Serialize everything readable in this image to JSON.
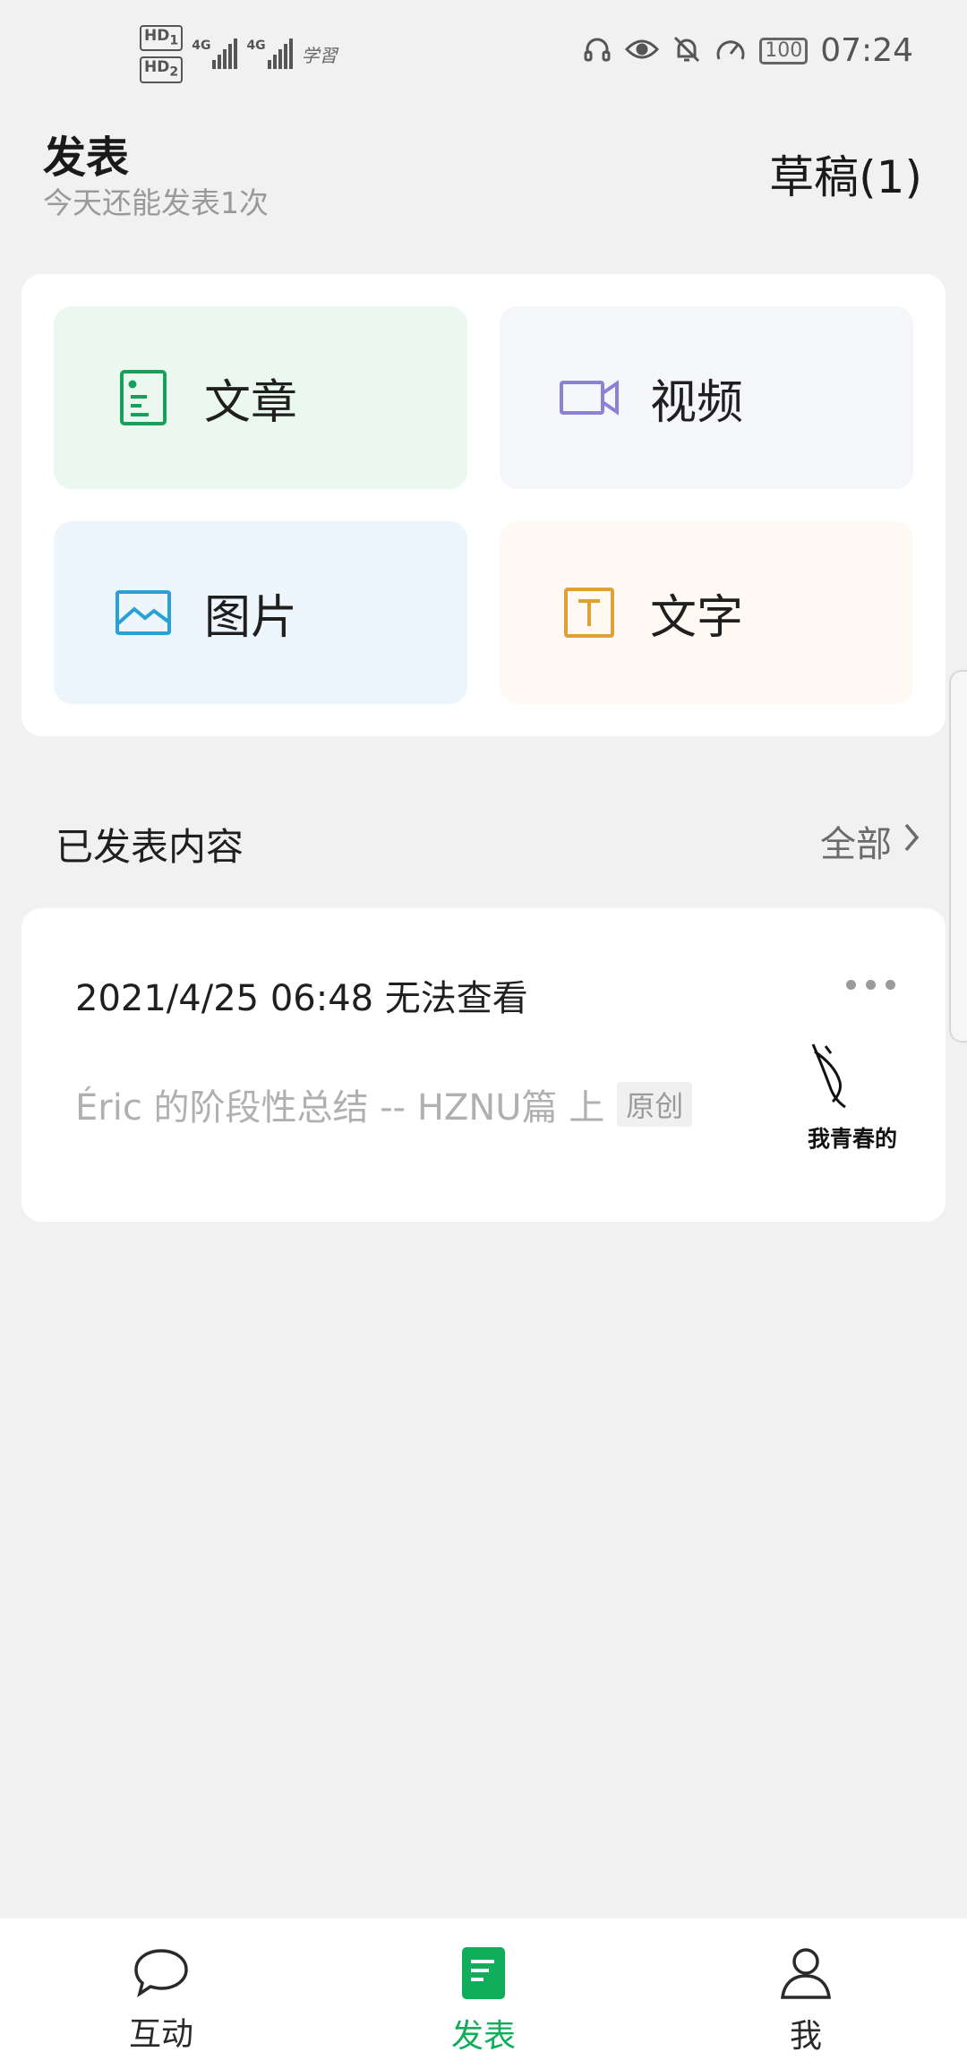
{
  "status_bar": {
    "hd1": "HD",
    "hd1_index": "1",
    "hd2": "HD",
    "hd2_index": "2",
    "sim1_network": "4G",
    "sim2_network": "4G",
    "carrier_note": "学習",
    "battery": "100",
    "time": "07:24"
  },
  "header": {
    "title": "发表",
    "subtitle": "今天还能发表1次",
    "drafts": "草稿(1)"
  },
  "publish_options": [
    {
      "label": "文章",
      "icon": "article-icon",
      "color": "#1a9e5c"
    },
    {
      "label": "视频",
      "icon": "video-icon",
      "color": "#8b82d4"
    },
    {
      "label": "图片",
      "icon": "image-icon",
      "color": "#28a2d6"
    },
    {
      "label": "文字",
      "icon": "text-icon",
      "color": "#e0a035"
    }
  ],
  "published": {
    "section_title": "已发表内容",
    "view_all": "全部",
    "posts": [
      {
        "datetime_status": "2021/4/25 06:48 无法查看",
        "title": "Éric 的阶段性总结 -- HZNU篇 上",
        "tag": "原创",
        "thumbnail_text": "我青春的"
      }
    ]
  },
  "bottom_nav": [
    {
      "label": "互动",
      "icon": "chat-bubble-icon",
      "active": false
    },
    {
      "label": "发表",
      "icon": "publish-doc-icon",
      "active": true
    },
    {
      "label": "我",
      "icon": "person-icon",
      "active": false
    }
  ],
  "colors": {
    "accent": "#10ad5a",
    "background": "#f1f1f1"
  }
}
